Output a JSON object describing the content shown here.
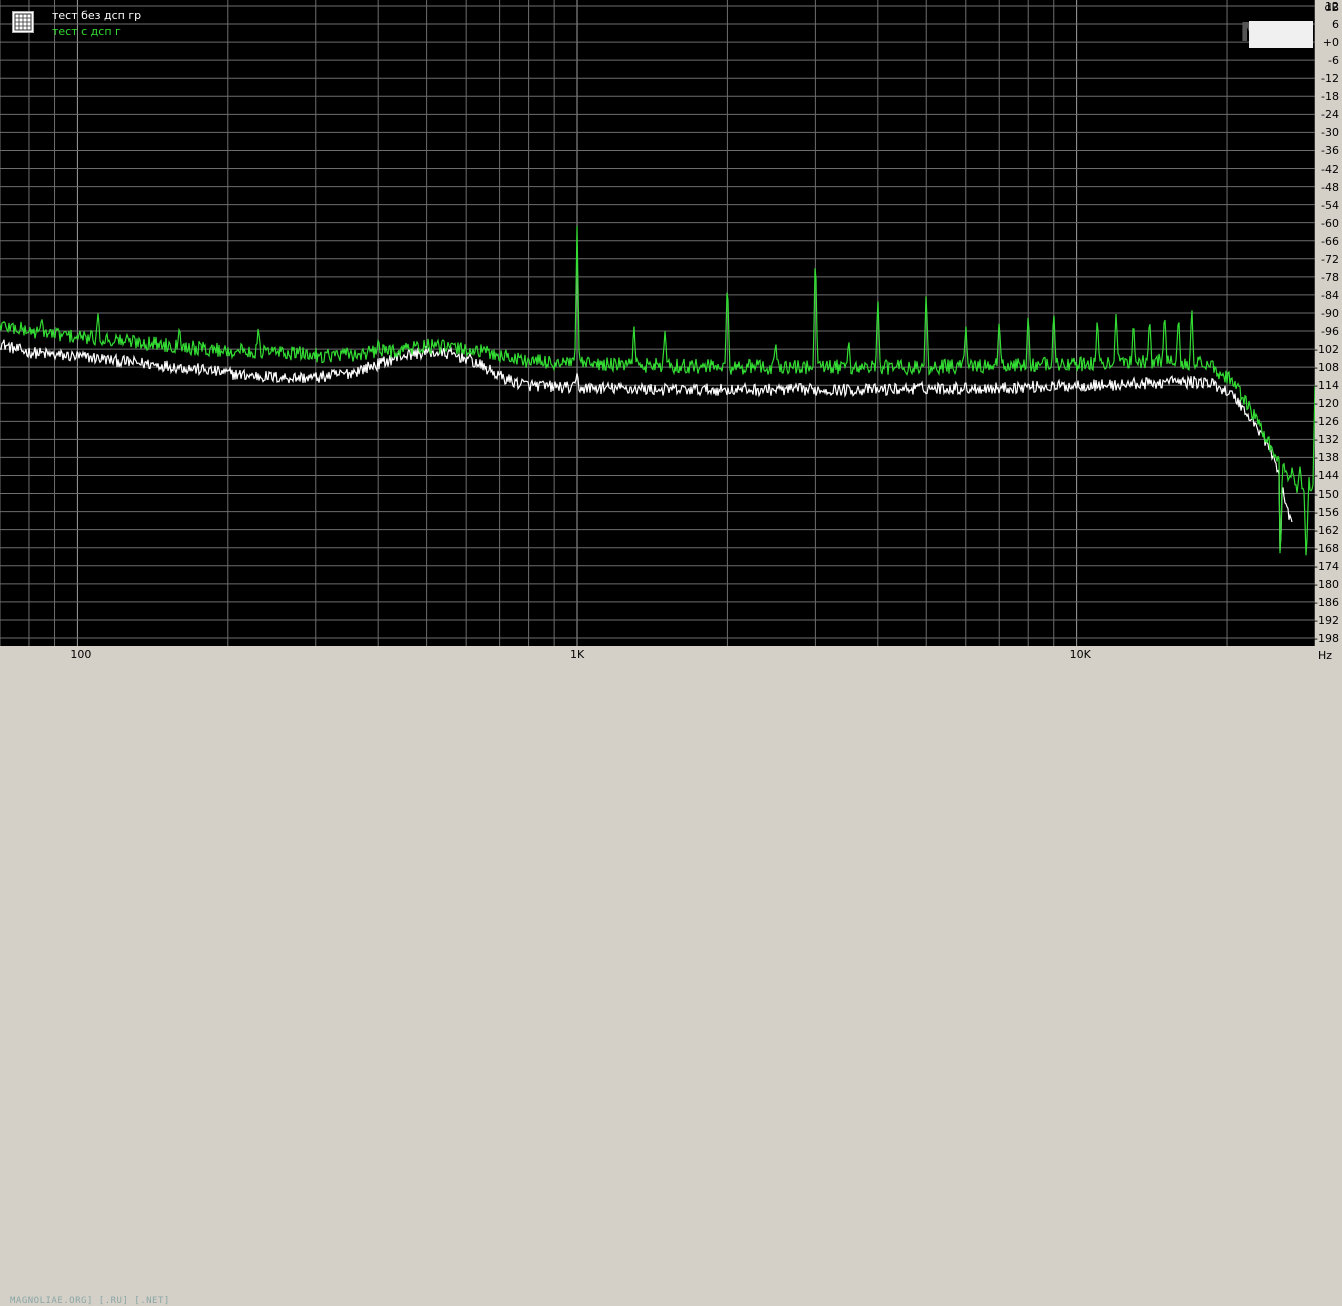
{
  "legend": {
    "series_1": "тест без дсп гр",
    "series_2": "тест с дсп г"
  },
  "units": {
    "x": "Hz",
    "y": "dB"
  },
  "watermark": "MAGNOLIAE.ORG] [.RU] [.NET]",
  "colors": {
    "background": "#000000",
    "grid": "#808080",
    "series_1": "#ffffff",
    "series_2": "#33dd33",
    "panel": "#d4d0c8"
  },
  "chart_data": {
    "type": "line",
    "x_scale": "log",
    "xlim": [
      70,
      30000
    ],
    "ylim": [
      -198,
      12
    ],
    "grid": true,
    "legend_placement": "top-left",
    "x_tick_labels": [
      {
        "value": 100,
        "label": "100"
      },
      {
        "value": 1000,
        "label": "1K"
      },
      {
        "value": 10000,
        "label": "10K"
      }
    ],
    "y_ticks": [
      12,
      6,
      0,
      -6,
      -12,
      -18,
      -24,
      -30,
      -36,
      -42,
      -48,
      -54,
      -60,
      -66,
      -72,
      -78,
      -84,
      -90,
      -96,
      -102,
      -108,
      -114,
      -120,
      -126,
      -132,
      -138,
      -144,
      -150,
      -156,
      -162,
      -168,
      -174,
      -180,
      -186,
      -192,
      -198
    ],
    "y_tick_labels": [
      "12",
      "6",
      "+0",
      "-6",
      "-12",
      "-18",
      "-24",
      "-30",
      "-36",
      "-42",
      "-48",
      "-54",
      "-60",
      "-66",
      "-72",
      "-78",
      "-84",
      "-90",
      "-96",
      "-102",
      "-108",
      "-114",
      "-120",
      "-126",
      "-132",
      "-138",
      "-144",
      "-150",
      "-156",
      "-162",
      "-168",
      "-174",
      "-180",
      "-186",
      "-192",
      "-198"
    ],
    "series": [
      {
        "name": "тест без дсп гр",
        "color": "#ffffff",
        "points": [
          [
            70,
            -100
          ],
          [
            75,
            -102
          ],
          [
            80,
            -103
          ],
          [
            85,
            -103.5
          ],
          [
            90,
            -104
          ],
          [
            100,
            -104.5
          ],
          [
            110,
            -105
          ],
          [
            120,
            -106
          ],
          [
            130,
            -106.5
          ],
          [
            140,
            -107
          ],
          [
            150,
            -107.5
          ],
          [
            160,
            -108
          ],
          [
            170,
            -108.5
          ],
          [
            180,
            -109
          ],
          [
            190,
            -109.5
          ],
          [
            200,
            -110
          ],
          [
            210,
            -110.5
          ],
          [
            230,
            -111
          ],
          [
            260,
            -111.5
          ],
          [
            300,
            -111.5
          ],
          [
            350,
            -110
          ],
          [
            400,
            -107
          ],
          [
            450,
            -104
          ],
          [
            500,
            -103
          ],
          [
            550,
            -103.5
          ],
          [
            600,
            -105
          ],
          [
            650,
            -108
          ],
          [
            700,
            -111
          ],
          [
            750,
            -113
          ],
          [
            800,
            -114
          ],
          [
            900,
            -114.5
          ],
          [
            1000,
            -115
          ],
          [
            1200,
            -115
          ],
          [
            1500,
            -115.5
          ],
          [
            2000,
            -115.5
          ],
          [
            2500,
            -115.5
          ],
          [
            3000,
            -115.5
          ],
          [
            4000,
            -115.5
          ],
          [
            5000,
            -115
          ],
          [
            6000,
            -115
          ],
          [
            7000,
            -115
          ],
          [
            8000,
            -114.5
          ],
          [
            9000,
            -114.5
          ],
          [
            10000,
            -114
          ],
          [
            11000,
            -114
          ],
          [
            12000,
            -114
          ],
          [
            13000,
            -113.5
          ],
          [
            14000,
            -113.5
          ],
          [
            15000,
            -113
          ],
          [
            16000,
            -113
          ],
          [
            17000,
            -113
          ],
          [
            18000,
            -113
          ],
          [
            19000,
            -114
          ],
          [
            20000,
            -116
          ],
          [
            21000,
            -119
          ],
          [
            22000,
            -124
          ],
          [
            23000,
            -128
          ],
          [
            24000,
            -133
          ],
          [
            25000,
            -140
          ],
          [
            26000,
            -150
          ],
          [
            26500,
            -157
          ],
          [
            27000,
            -161
          ]
        ],
        "peaks": [
          [
            1000,
            -110
          ],
          [
            15500,
            -111
          ]
        ]
      },
      {
        "name": "тест с дсп г",
        "color": "#33dd33",
        "points": [
          [
            70,
            -94
          ],
          [
            80,
            -96
          ],
          [
            90,
            -97
          ],
          [
            100,
            -98
          ],
          [
            120,
            -99
          ],
          [
            140,
            -100
          ],
          [
            160,
            -101
          ],
          [
            180,
            -102
          ],
          [
            200,
            -102.5
          ],
          [
            250,
            -103
          ],
          [
            300,
            -104
          ],
          [
            350,
            -104
          ],
          [
            400,
            -103
          ],
          [
            450,
            -102
          ],
          [
            500,
            -101
          ],
          [
            600,
            -102
          ],
          [
            700,
            -104
          ],
          [
            800,
            -106
          ],
          [
            1000,
            -107
          ],
          [
            1500,
            -107.5
          ],
          [
            2000,
            -108
          ],
          [
            3000,
            -108
          ],
          [
            4000,
            -108
          ],
          [
            5000,
            -108
          ],
          [
            7000,
            -107.5
          ],
          [
            10000,
            -107
          ],
          [
            12000,
            -106.5
          ],
          [
            14000,
            -106
          ],
          [
            16000,
            -106
          ],
          [
            18000,
            -107
          ],
          [
            19000,
            -109
          ],
          [
            20000,
            -111
          ],
          [
            21000,
            -115
          ],
          [
            22000,
            -121
          ],
          [
            23000,
            -126
          ],
          [
            24000,
            -132
          ],
          [
            25000,
            -138
          ],
          [
            26000,
            -144
          ],
          [
            27000,
            -147
          ],
          [
            28000,
            -148
          ],
          [
            29000,
            -148
          ],
          [
            30000,
            -148
          ]
        ],
        "peaks": [
          [
            85,
            -92
          ],
          [
            110,
            -90
          ],
          [
            160,
            -94
          ],
          [
            230,
            -95
          ],
          [
            400,
            -99
          ],
          [
            1000,
            -61
          ],
          [
            1300,
            -94
          ],
          [
            1500,
            -96
          ],
          [
            2000,
            -78
          ],
          [
            2500,
            -100
          ],
          [
            3000,
            -68
          ],
          [
            3500,
            -99
          ],
          [
            4000,
            -84
          ],
          [
            5000,
            -82
          ],
          [
            6000,
            -93
          ],
          [
            7000,
            -92
          ],
          [
            8000,
            -90
          ],
          [
            9000,
            -89
          ],
          [
            11000,
            -91
          ],
          [
            12000,
            -89
          ],
          [
            13000,
            -92
          ],
          [
            14000,
            -91
          ],
          [
            15000,
            -89
          ],
          [
            16000,
            -90
          ],
          [
            17000,
            -87
          ],
          [
            19000,
            -112
          ],
          [
            20000,
            -115
          ],
          [
            21000,
            -118
          ],
          [
            22000,
            -122
          ],
          [
            23000,
            -128
          ],
          [
            24000,
            -133
          ],
          [
            25000,
            -137
          ],
          [
            26000,
            -140
          ],
          [
            27000,
            -141
          ],
          [
            28000,
            -141
          ],
          [
            29000,
            -130
          ],
          [
            30000,
            -114
          ]
        ]
      }
    ]
  }
}
